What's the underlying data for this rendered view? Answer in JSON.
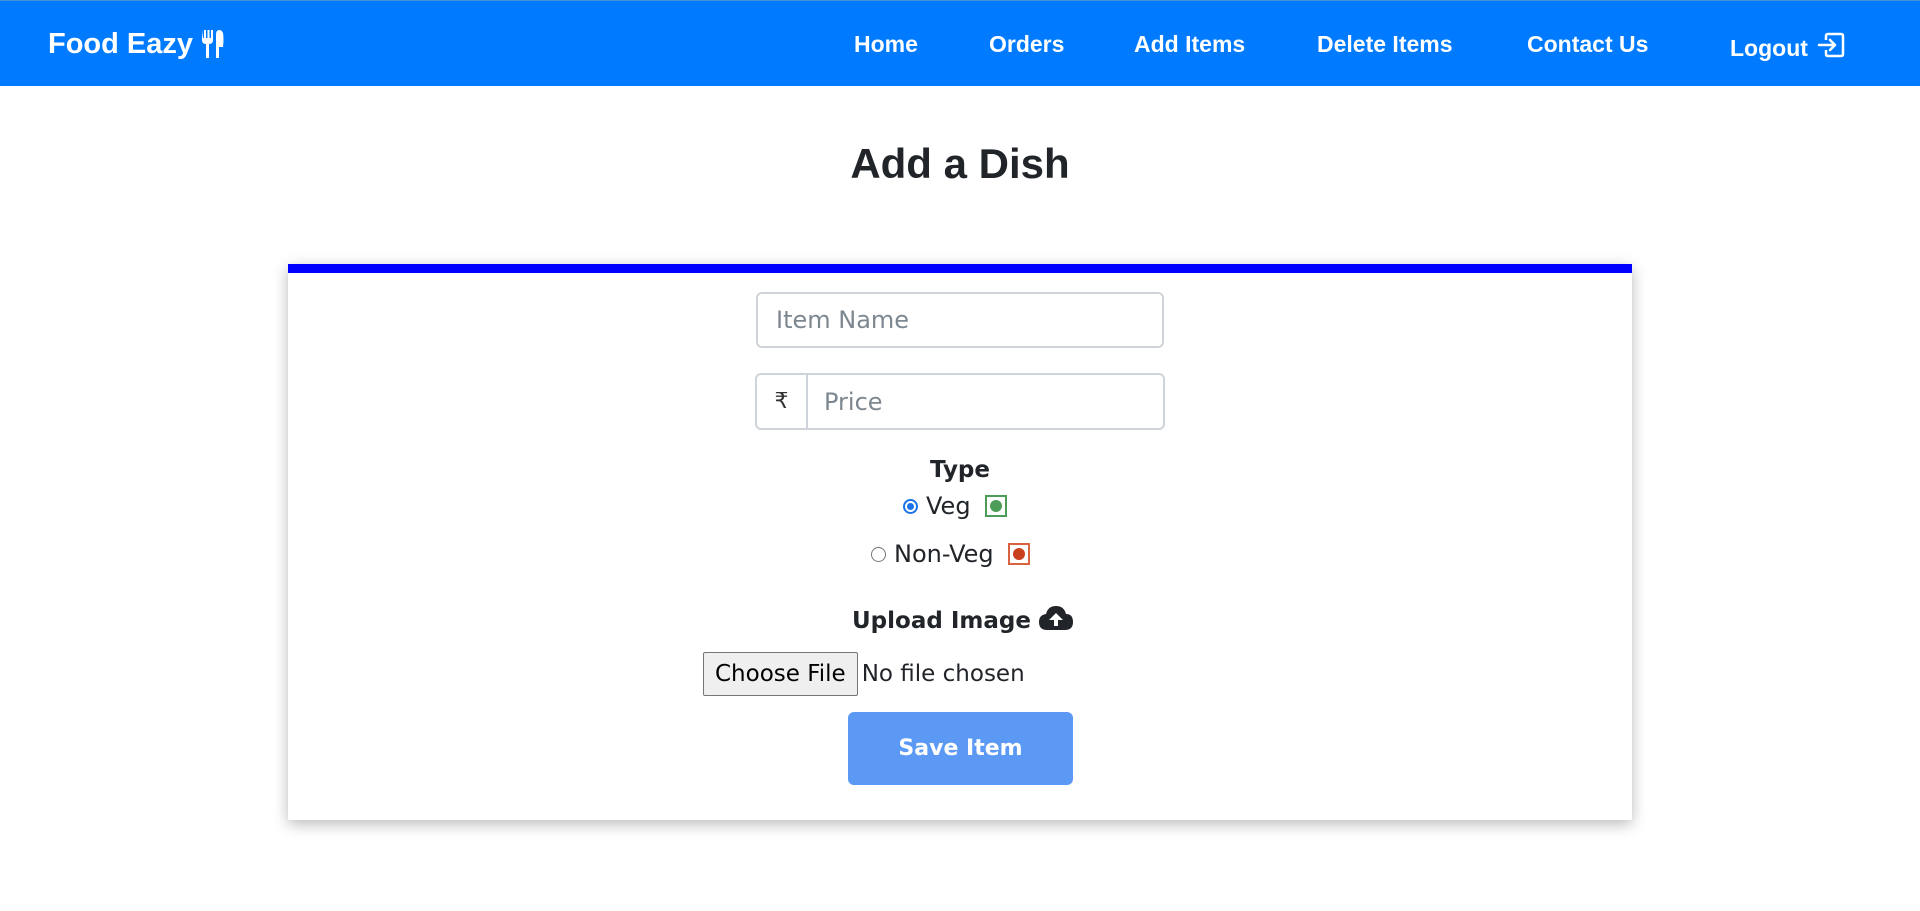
{
  "navbar": {
    "brand": "Food Eazy",
    "brand_icon": "fork-knife-icon",
    "links": [
      "Home",
      "Orders",
      "Add Items",
      "Delete Items",
      "Contact Us"
    ],
    "logout": "Logout",
    "logout_icon": "box-arrow-right-icon",
    "bg_color": "#007bff"
  },
  "page": {
    "title": "Add a Dish"
  },
  "form": {
    "item_name_placeholder": "Item Name",
    "currency_symbol": "₹",
    "price_placeholder": "Price",
    "type_label": "Type",
    "types": [
      {
        "label": "Veg",
        "checked": true,
        "mark_color": "#2e8b3a"
      },
      {
        "label": "Non-Veg",
        "checked": false,
        "mark_color": "#c9401c"
      }
    ],
    "upload_label": "Upload Image",
    "upload_icon": "cloud-upload-icon",
    "choose_file_label": "Choose File",
    "file_status": "No file chosen",
    "save_label": "Save Item",
    "card_accent": "#0000ff",
    "save_color": "#5b99f5"
  }
}
